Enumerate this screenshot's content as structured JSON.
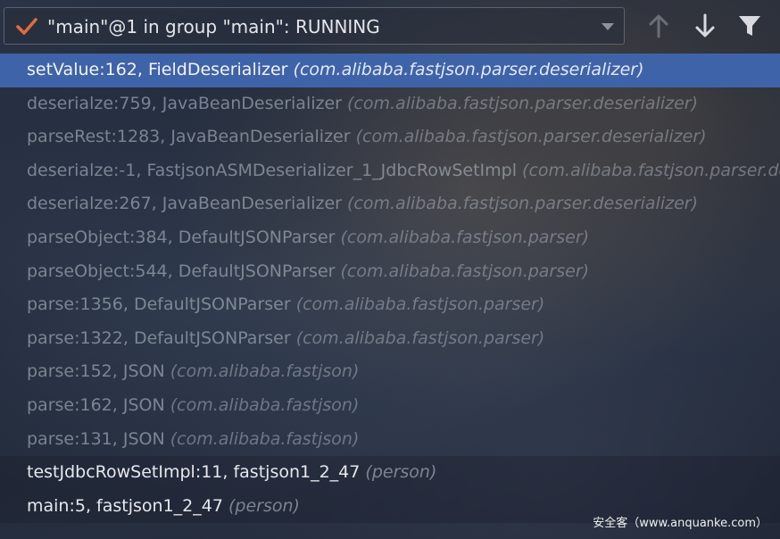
{
  "toolbar": {
    "thread_label": "\"main\"@1 in group \"main\": RUNNING",
    "check_icon": "checkmark-icon",
    "dropdown_icon": "chevron-down-icon",
    "up_icon": "arrow-up-icon",
    "down_icon": "arrow-down-icon",
    "filter_icon": "filter-icon"
  },
  "frames": [
    {
      "method": "setValue:162, FieldDeserializer ",
      "pkg": "(com.alibaba.fastjson.parser.deserializer)",
      "state": "selected"
    },
    {
      "method": "deserialze:759, JavaBeanDeserializer ",
      "pkg": "(com.alibaba.fastjson.parser.deserializer)",
      "state": "dim"
    },
    {
      "method": "parseRest:1283, JavaBeanDeserializer ",
      "pkg": "(com.alibaba.fastjson.parser.deserializer)",
      "state": "dim"
    },
    {
      "method": "deserialze:-1, FastjsonASMDeserializer_1_JdbcRowSetImpl ",
      "pkg": "(com.alibaba.fastjson.parser.deserializer)",
      "state": "dim"
    },
    {
      "method": "deserialze:267, JavaBeanDeserializer ",
      "pkg": "(com.alibaba.fastjson.parser.deserializer)",
      "state": "dim"
    },
    {
      "method": "parseObject:384, DefaultJSONParser ",
      "pkg": "(com.alibaba.fastjson.parser)",
      "state": "dim"
    },
    {
      "method": "parseObject:544, DefaultJSONParser ",
      "pkg": "(com.alibaba.fastjson.parser)",
      "state": "dim"
    },
    {
      "method": "parse:1356, DefaultJSONParser ",
      "pkg": "(com.alibaba.fastjson.parser)",
      "state": "dim"
    },
    {
      "method": "parse:1322, DefaultJSONParser ",
      "pkg": "(com.alibaba.fastjson.parser)",
      "state": "dim"
    },
    {
      "method": "parse:152, JSON ",
      "pkg": "(com.alibaba.fastjson)",
      "state": "dim"
    },
    {
      "method": "parse:162, JSON ",
      "pkg": "(com.alibaba.fastjson)",
      "state": "dim"
    },
    {
      "method": "parse:131, JSON ",
      "pkg": "(com.alibaba.fastjson)",
      "state": "dim"
    },
    {
      "method": "testJdbcRowSetImpl:11, fastjson1_2_47 ",
      "pkg": "(person)",
      "state": "bright"
    },
    {
      "method": "main:5, fastjson1_2_47 ",
      "pkg": "(person)",
      "state": "bright"
    }
  ],
  "watermark": "安全客（www.anquanke.com）",
  "colors": {
    "selection": "#3f63a8",
    "check": "#e06c3c",
    "icons": "#d8dadf"
  }
}
